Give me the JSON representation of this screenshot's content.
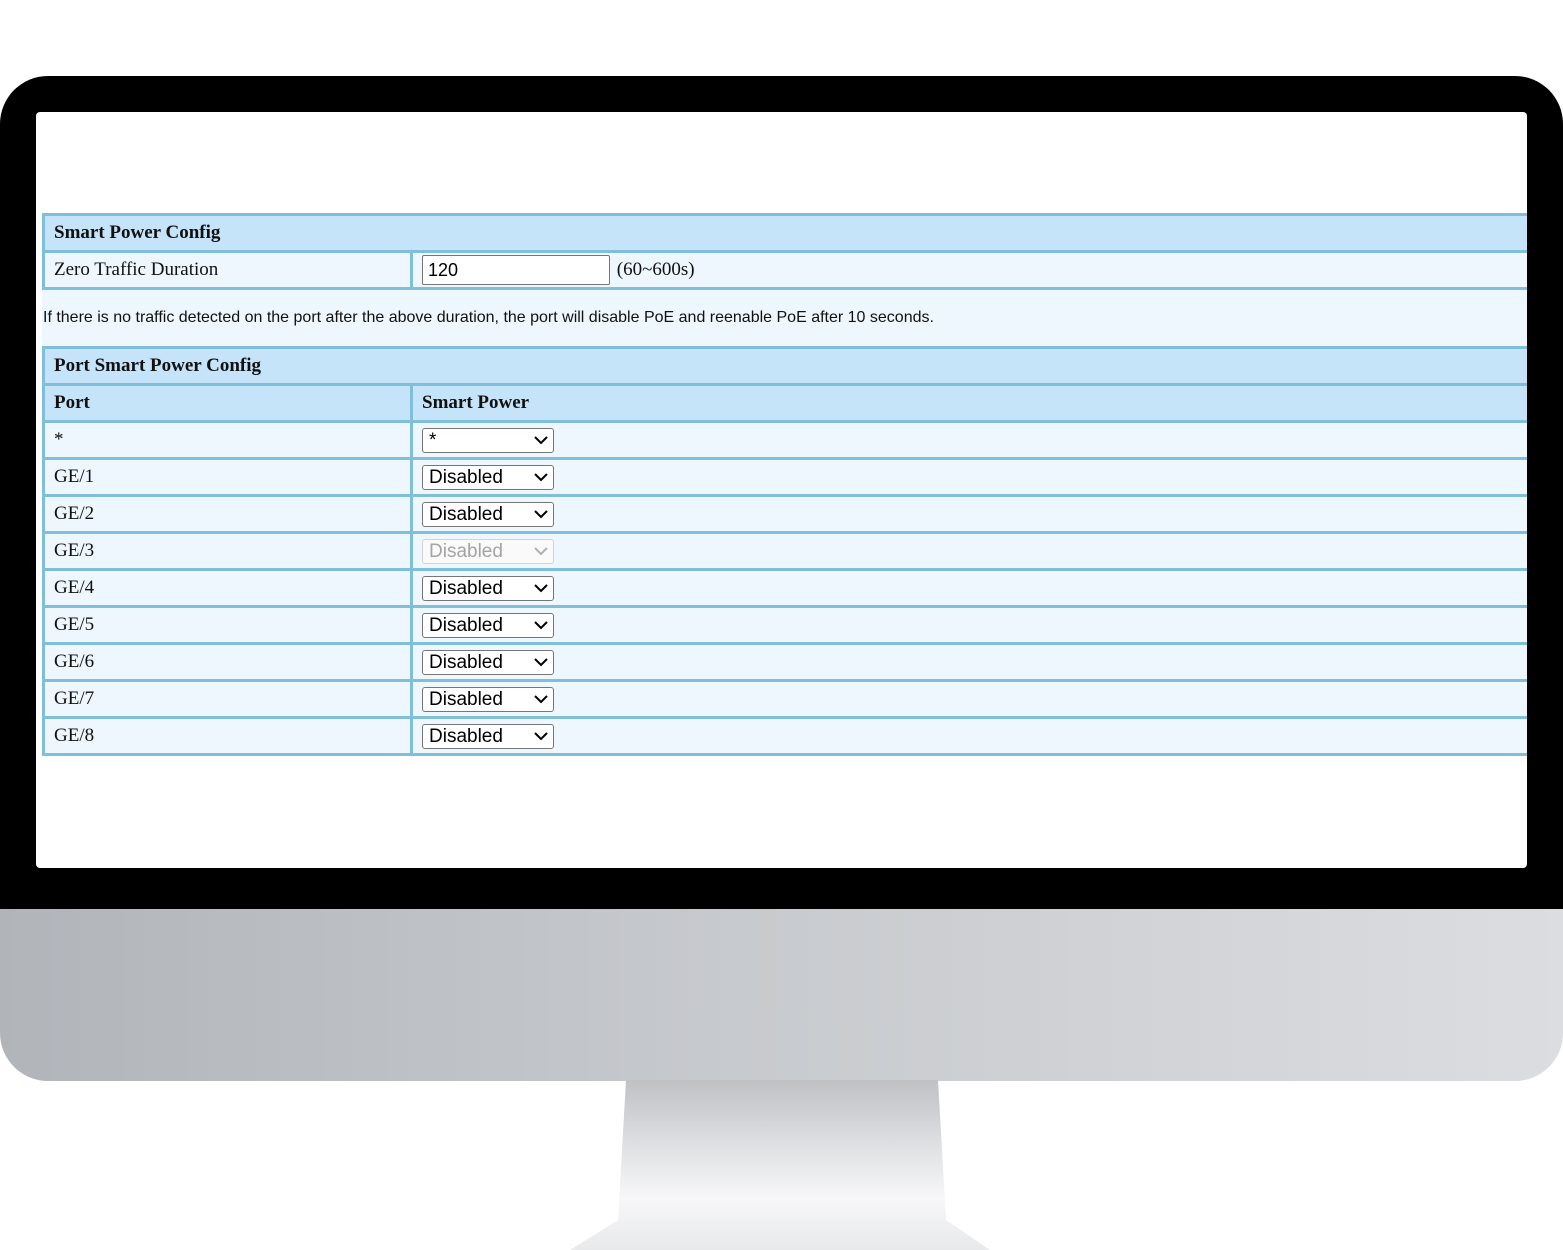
{
  "smart_power_config": {
    "title": "Smart Power Config",
    "zero_traffic_label": "Zero Traffic Duration",
    "zero_traffic_value": "120",
    "zero_traffic_range": "(60~600s)"
  },
  "note": "If there is no traffic detected on the port after the above duration, the port will disable PoE and reenable PoE after 10 seconds.",
  "port_config": {
    "title": "Port Smart Power Config",
    "col_port": "Port",
    "col_smart_power": "Smart Power",
    "rows": [
      {
        "port": "*",
        "value": "*",
        "disabled": false
      },
      {
        "port": "GE/1",
        "value": "Disabled",
        "disabled": false
      },
      {
        "port": "GE/2",
        "value": "Disabled",
        "disabled": false
      },
      {
        "port": "GE/3",
        "value": "Disabled",
        "disabled": true
      },
      {
        "port": "GE/4",
        "value": "Disabled",
        "disabled": false
      },
      {
        "port": "GE/5",
        "value": "Disabled",
        "disabled": false
      },
      {
        "port": "GE/6",
        "value": "Disabled",
        "disabled": false
      },
      {
        "port": "GE/7",
        "value": "Disabled",
        "disabled": false
      },
      {
        "port": "GE/8",
        "value": "Disabled",
        "disabled": false
      }
    ]
  },
  "colors": {
    "header_bg": "#c5e4f9",
    "row_bg": "#eef7fd",
    "border": "#7fbfd9",
    "bezel": "#000000"
  },
  "icons": {
    "select_arrow": "chevron-down-icon"
  }
}
